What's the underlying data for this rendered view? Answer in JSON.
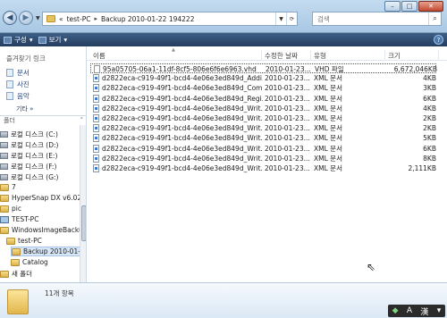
{
  "window": {
    "controls": [
      "–",
      "□",
      "✕"
    ]
  },
  "address": {
    "crumbs": [
      "test-PC",
      "Backup 2010-01-22 194222"
    ],
    "prefix": "«"
  },
  "search": {
    "placeholder": "검색"
  },
  "toolbar": {
    "organize": "구성",
    "views": "보기"
  },
  "nav": {
    "favorites_title": "즐겨찾기 링크",
    "favorites": [
      "문서",
      "사진",
      "음악"
    ],
    "more": "기타 »",
    "folders_title": "폴더",
    "tree": [
      "로컬 디스크 (C:)",
      "로컬 디스크 (D:)",
      "로컬 디스크 (E:)",
      "로컬 디스크 (F:)",
      "로컬 디스크 (G:)",
      "7",
      "HyperSnap DX v6.02",
      "pic",
      "TEST-PC",
      "WindowsImageBackup",
      "test-PC",
      "Backup 2010-01-",
      "Catalog",
      "새 폴더"
    ]
  },
  "columns": {
    "name": "이름",
    "date": "수정한 날짜",
    "type": "유형",
    "size": "크기"
  },
  "files": [
    {
      "name": "95a05705-06a1-11df-8cf5-806e6f6e6963.vhd",
      "date": "2010-01-23...",
      "type": "VHD 파일",
      "size": "6,672,046KB",
      "kind": "vhd"
    },
    {
      "name": "d2822eca-c919-49f1-bcd4-4e06e3ed849d_Addi...",
      "date": "2010-01-23...",
      "type": "XML 문서",
      "size": "4KB",
      "kind": "xml"
    },
    {
      "name": "d2822eca-c919-49f1-bcd4-4e06e3ed849d_Com...",
      "date": "2010-01-23...",
      "type": "XML 문서",
      "size": "3KB",
      "kind": "xml"
    },
    {
      "name": "d2822eca-c919-49f1-bcd4-4e06e3ed849d_Regi...",
      "date": "2010-01-23...",
      "type": "XML 문서",
      "size": "6KB",
      "kind": "xml"
    },
    {
      "name": "d2822eca-c919-49f1-bcd4-4e06e3ed849d_Writ...",
      "date": "2010-01-23...",
      "type": "XML 문서",
      "size": "4KB",
      "kind": "xml"
    },
    {
      "name": "d2822eca-c919-49f1-bcd4-4e06e3ed849d_Writ...",
      "date": "2010-01-23...",
      "type": "XML 문서",
      "size": "2KB",
      "kind": "xml"
    },
    {
      "name": "d2822eca-c919-49f1-bcd4-4e06e3ed849d_Writ...",
      "date": "2010-01-23...",
      "type": "XML 문서",
      "size": "2KB",
      "kind": "xml"
    },
    {
      "name": "d2822eca-c919-49f1-bcd4-4e06e3ed849d_Writ...",
      "date": "2010-01-23...",
      "type": "XML 문서",
      "size": "5KB",
      "kind": "xml"
    },
    {
      "name": "d2822eca-c919-49f1-bcd4-4e06e3ed849d_Writ...",
      "date": "2010-01-23...",
      "type": "XML 문서",
      "size": "6KB",
      "kind": "xml"
    },
    {
      "name": "d2822eca-c919-49f1-bcd4-4e06e3ed849d_Writ...",
      "date": "2010-01-23...",
      "type": "XML 문서",
      "size": "8KB",
      "kind": "xml"
    },
    {
      "name": "d2822eca-c919-49f1-bcd4-4e06e3ed849d_Writ...",
      "date": "2010-01-23...",
      "type": "XML 문서",
      "size": "2,111KB",
      "kind": "xml"
    }
  ],
  "details": {
    "count": "11개 항목"
  },
  "ime": {
    "mode": "A",
    "hanja": "漢"
  }
}
